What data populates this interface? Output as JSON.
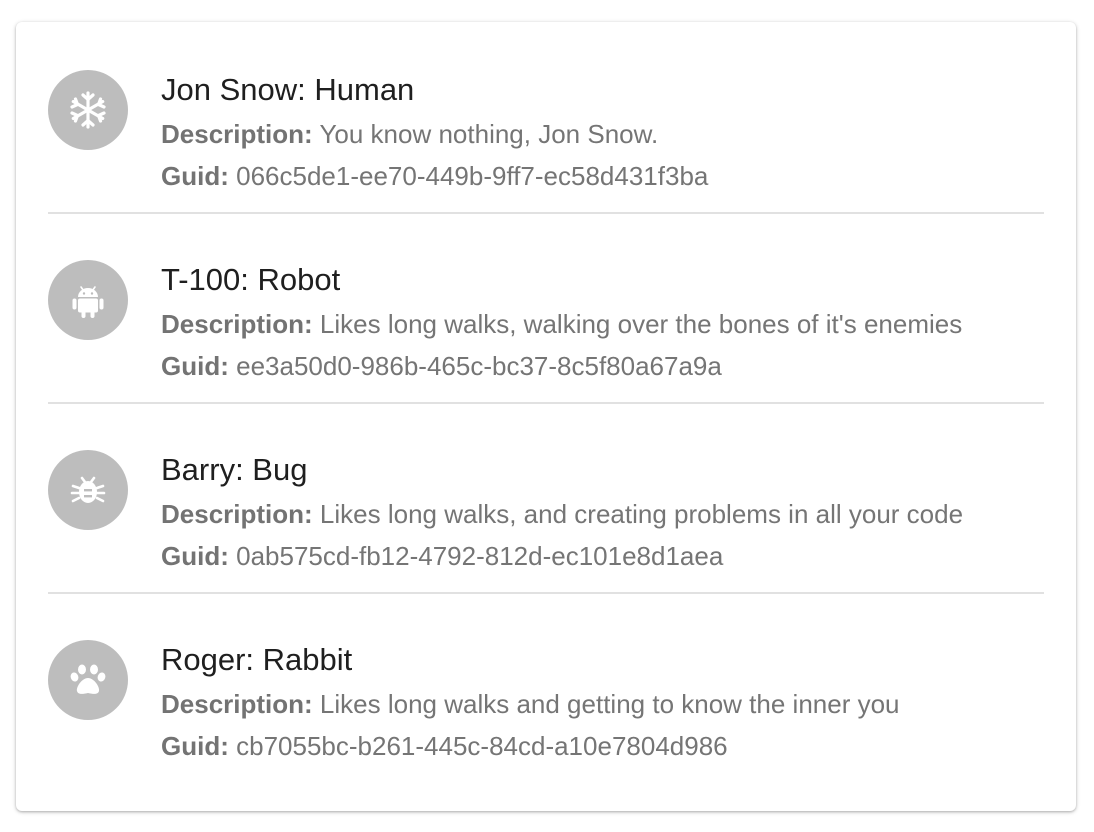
{
  "colors": {
    "avatar_bg": "#bdbdbd",
    "title_text": "#1f1f1f",
    "secondary_text": "#757575",
    "divider": "#e1e1e1"
  },
  "labels": {
    "description": "Description:",
    "guid": "Guid:"
  },
  "items": [
    {
      "icon": "snowflake-icon",
      "title": "Jon Snow: Human",
      "description": "You know nothing, Jon Snow.",
      "guid": "066c5de1-ee70-449b-9ff7-ec58d431f3ba"
    },
    {
      "icon": "android-robot-icon",
      "title": "T-100: Robot",
      "description": "Likes long walks, walking over the bones of it's enemies",
      "guid": "ee3a50d0-986b-465c-bc37-8c5f80a67a9a"
    },
    {
      "icon": "bug-icon",
      "title": "Barry: Bug",
      "description": "Likes long walks, and creating problems in all your code",
      "guid": "0ab575cd-fb12-4792-812d-ec101e8d1aea"
    },
    {
      "icon": "paw-icon",
      "title": "Roger: Rabbit",
      "description": "Likes long walks and getting to know the inner you",
      "guid": "cb7055bc-b261-445c-84cd-a10e7804d986"
    }
  ]
}
